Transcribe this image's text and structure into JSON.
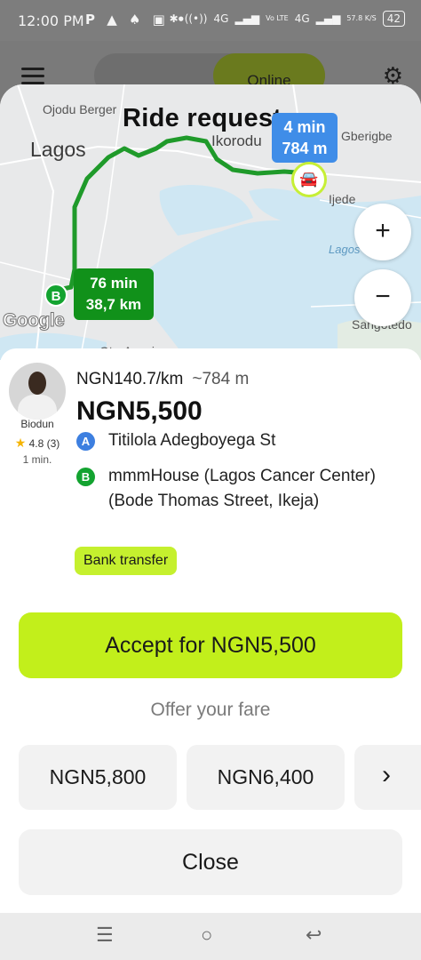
{
  "status_bar": {
    "time": "12:00 PM",
    "notification_icons": "P ▲ ♠ ▣ •",
    "network_left": "4G",
    "network_lte": "Vo LTE",
    "network_right": "4G",
    "speed": "57.8 K/S",
    "battery": "42"
  },
  "header": {
    "status_toggle": "Online"
  },
  "map": {
    "title": "Ride request",
    "places": {
      "ojodu_berger": "Ojodu Berger",
      "lagos": "Lagos",
      "ikorodu": "Ikorodu",
      "gberigbe": "Gberigbe",
      "ijede": "Ijede",
      "lagos_lagoon": "Lagos",
      "sangotedo": "Sangotedo",
      "oto_awori": "Oto-Awori"
    },
    "pickup_eta": {
      "time": "4 min",
      "distance": "784 m"
    },
    "trip_eta": {
      "time": "76 min",
      "distance": "38,7 km"
    },
    "destination_marker": "B",
    "attribution": "Google",
    "zoom_in": "+",
    "zoom_out": "−"
  },
  "driver": {
    "name": "Biodun",
    "rating": "4.8 (3)",
    "last_seen": "1 min."
  },
  "offer": {
    "rate": "NGN140.7/km",
    "pickup_distance": "~784 m",
    "price": "NGN5,500",
    "pickup_marker": "A",
    "pickup_address": "Titilola Adegboyega St",
    "dropoff_marker": "B",
    "dropoff_address": "mmmHouse (Lagos Cancer Center) (Bode Thomas Street, Ikeja)",
    "payment_method": "Bank transfer"
  },
  "actions": {
    "accept_label": "Accept for NGN5,500",
    "offer_fare_label": "Offer your fare",
    "fare_options": [
      "NGN5,800",
      "NGN6,400"
    ],
    "close_label": "Close"
  },
  "colors": {
    "accent_lime": "#c2ef1b",
    "route_green": "#1f9a2a",
    "eta_blue": "#3f8de8",
    "marker_green": "#13a330",
    "marker_blue": "#3d7fe0"
  },
  "icons": {
    "menu": "hamburger-icon",
    "settings": "gear-icon",
    "car": "car-icon",
    "next": "chevron-right-icon",
    "nav_recent": "recents-icon",
    "nav_home": "home-icon",
    "nav_back": "back-icon"
  }
}
